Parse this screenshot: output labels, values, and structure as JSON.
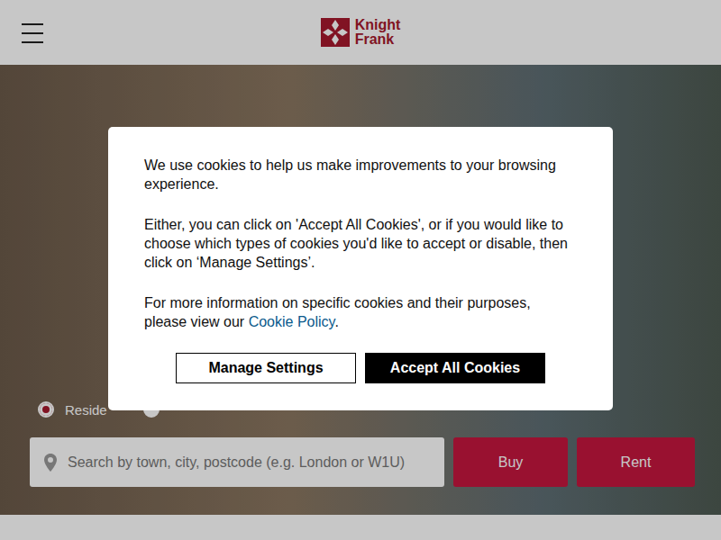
{
  "header": {
    "logo": {
      "line1": "Knight",
      "line2": "Frank"
    }
  },
  "hero": {
    "property_types": [
      {
        "label": "Reside",
        "selected": true
      },
      {
        "label": "",
        "selected": false
      }
    ],
    "search": {
      "placeholder": "Search by town, city, postcode (e.g. London or W1U)"
    },
    "actions": [
      "Buy",
      "Rent"
    ]
  },
  "cookie_dialog": {
    "paragraphs": [
      "We use cookies to help us make improvements to your browsing experience.",
      "Either, you can click on 'Accept All Cookies', or if you would like to choose which types of cookies you'd like to accept or disable, then click on ‘Manage Settings’."
    ],
    "policy": {
      "before": "For more information on specific cookies and their purposes, please view our ",
      "link": "Cookie Policy",
      "after": "."
    },
    "buttons": [
      {
        "label": "Manage Settings",
        "kind": "outline"
      },
      {
        "label": "Accept All Cookies",
        "kind": "filled"
      }
    ]
  }
}
